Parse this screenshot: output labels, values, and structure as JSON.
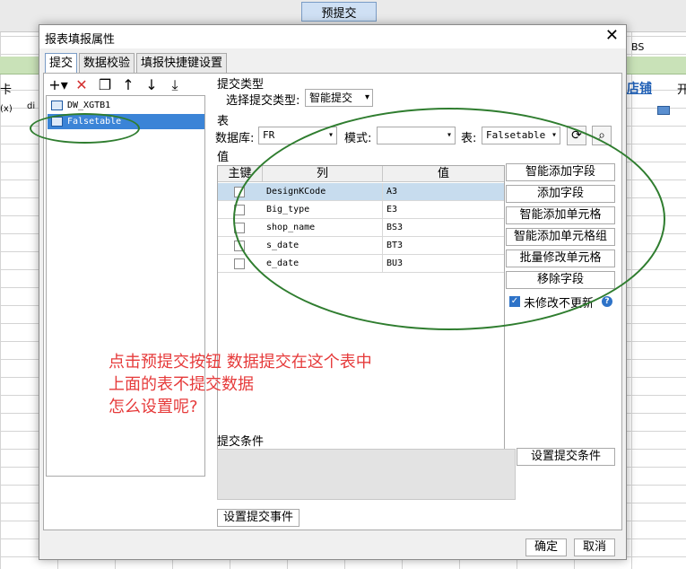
{
  "sheet": {
    "preview_button": "预提交",
    "header_cells": [
      "BS",
      "卡",
      "店铺",
      "开",
      "(x)",
      "di"
    ]
  },
  "dialog": {
    "title": "报表填报属性",
    "tabs": [
      "提交",
      "数据校验",
      "填报快捷键设置"
    ],
    "tree_items": [
      "DW_XGTB1",
      "Falsetable"
    ],
    "submit_type": {
      "section": "提交类型",
      "label": "选择提交类型:",
      "value": "智能提交"
    },
    "table_section": {
      "section": "表",
      "db_label": "数据库:",
      "db_value": "FR",
      "schema_label": "模式:",
      "schema_value": "",
      "table_label": "表:",
      "table_value": "Falsetable"
    },
    "value_section": "值",
    "columns": [
      "主键",
      "列",
      "值"
    ],
    "rows": [
      {
        "col": "DesignKCode",
        "val": "A3"
      },
      {
        "col": "Big_type",
        "val": "E3"
      },
      {
        "col": "shop_name",
        "val": "BS3"
      },
      {
        "col": "s_date",
        "val": "BT3"
      },
      {
        "col": "e_date",
        "val": "BU3"
      }
    ],
    "side_buttons": [
      "智能添加字段",
      "添加字段",
      "智能添加单元格",
      "智能添加单元格组",
      "批量修改单元格",
      "移除字段"
    ],
    "unmodified_checkbox": "未修改不更新",
    "condition_section": "提交条件",
    "set_condition_button": "设置提交条件",
    "set_event_button": "设置提交事件",
    "ok_button": "确定",
    "cancel_button": "取消"
  },
  "annotation": [
    "点击预提交按钮  数据提交在这个表中",
    "上面的表不提交数据",
    "怎么设置呢?"
  ],
  "colors": {
    "accent": "#3b84d7",
    "annotation": "#e63b3b",
    "ellipse": "#2f7d2f"
  }
}
